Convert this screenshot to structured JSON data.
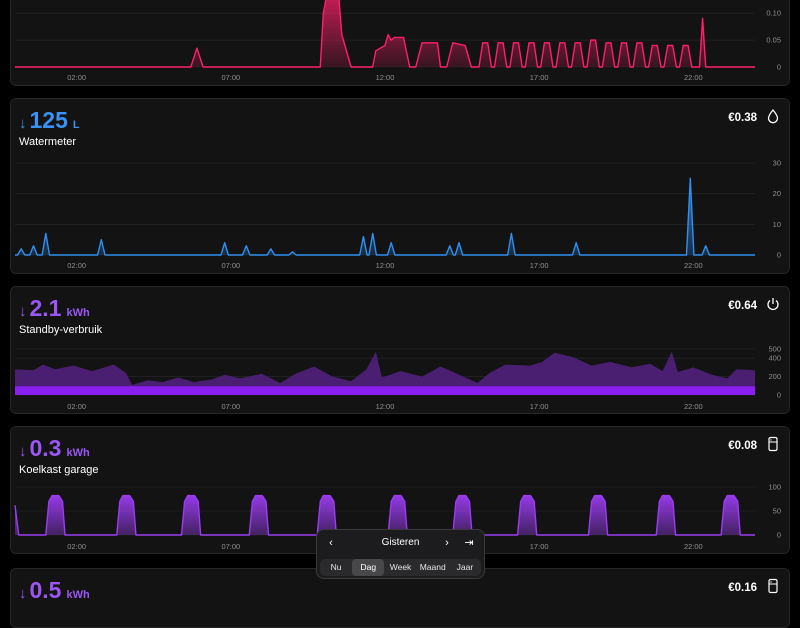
{
  "colors": {
    "gas": "#ff1f6b",
    "water": "#2f8ff0",
    "standby": "#8b2ce0",
    "fridge": "#9b3cf2",
    "label_purple": "#9b57f5",
    "label_blue": "#3a92f5"
  },
  "top_card": {
    "x_ticks": [
      "02:00",
      "07:00",
      "12:00",
      "17:00",
      "22:00"
    ],
    "y_ticks": [
      "0.10",
      "0.05",
      "0"
    ]
  },
  "water": {
    "arrow": "↓",
    "value": "125",
    "unit": "L",
    "title": "Watermeter",
    "cost": "€0.38",
    "icon": "water-drop-icon",
    "x_ticks": [
      "02:00",
      "07:00",
      "12:00",
      "17:00",
      "22:00"
    ],
    "y_ticks": [
      "30",
      "20",
      "10",
      "0"
    ]
  },
  "standby": {
    "arrow": "↓",
    "value": "2.1",
    "unit": "kWh",
    "title": "Standby-verbruik",
    "cost": "€0.64",
    "icon": "power-icon",
    "x_ticks": [
      "02:00",
      "07:00",
      "12:00",
      "17:00",
      "22:00"
    ],
    "y_ticks": [
      "500",
      "400",
      "200",
      "0"
    ]
  },
  "fridge": {
    "arrow": "↓",
    "value": "0.3",
    "unit": "kWh",
    "title": "Koelkast garage",
    "cost": "€0.08",
    "icon": "fridge-icon",
    "x_ticks": [
      "02:00",
      "07:00",
      "12:00",
      "17:00",
      "22:00"
    ],
    "y_ticks": [
      "100",
      "50",
      "0"
    ]
  },
  "fifth": {
    "arrow": "↓",
    "value": "0.5",
    "unit": "kWh",
    "cost": "€0.16",
    "icon": "fridge-icon"
  },
  "selector": {
    "label": "Gisteren",
    "prev": "‹",
    "next": "›",
    "last": "⇥",
    "tabs": [
      "Nu",
      "Dag",
      "Week",
      "Maand",
      "Jaar"
    ],
    "active_tab": "Dag"
  },
  "chart_data": [
    {
      "type": "area",
      "name": "top",
      "x_unit": "hour",
      "ylim": [
        0,
        0.13
      ],
      "points": [
        [
          0,
          0
        ],
        [
          5.7,
          0
        ],
        [
          5.9,
          0.035
        ],
        [
          6.1,
          0
        ],
        [
          9.9,
          0
        ],
        [
          10.0,
          0.1
        ],
        [
          10.1,
          0.13
        ],
        [
          10.5,
          0.13
        ],
        [
          10.6,
          0.06
        ],
        [
          10.9,
          0.0
        ],
        [
          11.6,
          0.0
        ],
        [
          11.7,
          0.03
        ],
        [
          12.0,
          0.04
        ],
        [
          12.1,
          0.06
        ],
        [
          12.2,
          0.05
        ],
        [
          12.3,
          0.055
        ],
        [
          12.6,
          0.055
        ],
        [
          12.8,
          0.0
        ],
        [
          13.0,
          0.0
        ],
        [
          13.2,
          0.045
        ],
        [
          13.7,
          0.045
        ],
        [
          13.8,
          0.0
        ],
        [
          14.0,
          0.0
        ],
        [
          14.2,
          0.045
        ],
        [
          14.6,
          0.04
        ],
        [
          14.8,
          0.0
        ],
        [
          22.2,
          0.0
        ],
        [
          22.3,
          0.09
        ],
        [
          22.4,
          0.0
        ],
        [
          24,
          0
        ]
      ],
      "pulses": [
        {
          "start": 15.1,
          "end": 15.4,
          "h": 0.045
        },
        {
          "start": 15.6,
          "end": 15.9,
          "h": 0.045
        },
        {
          "start": 16.1,
          "end": 16.4,
          "h": 0.045
        },
        {
          "start": 16.6,
          "end": 16.9,
          "h": 0.045
        },
        {
          "start": 17.1,
          "end": 17.4,
          "h": 0.045
        },
        {
          "start": 17.6,
          "end": 17.9,
          "h": 0.045
        },
        {
          "start": 18.1,
          "end": 18.4,
          "h": 0.045
        },
        {
          "start": 18.6,
          "end": 18.9,
          "h": 0.05
        },
        {
          "start": 19.1,
          "end": 19.4,
          "h": 0.045
        },
        {
          "start": 19.6,
          "end": 19.9,
          "h": 0.045
        },
        {
          "start": 20.1,
          "end": 20.4,
          "h": 0.045
        },
        {
          "start": 20.6,
          "end": 20.9,
          "h": 0.04
        },
        {
          "start": 21.1,
          "end": 21.4,
          "h": 0.04
        },
        {
          "start": 21.6,
          "end": 21.9,
          "h": 0.04
        }
      ]
    },
    {
      "type": "area",
      "name": "water",
      "x_unit": "hour",
      "ylim": [
        0,
        30
      ],
      "spikes": [
        [
          0.2,
          2
        ],
        [
          0.6,
          3
        ],
        [
          1.0,
          7
        ],
        [
          2.8,
          5
        ],
        [
          6.8,
          4
        ],
        [
          7.5,
          3
        ],
        [
          8.3,
          2
        ],
        [
          9.0,
          1
        ],
        [
          11.3,
          6
        ],
        [
          11.6,
          7
        ],
        [
          12.2,
          4
        ],
        [
          14.1,
          3
        ],
        [
          14.4,
          4
        ],
        [
          16.1,
          7
        ],
        [
          18.2,
          4
        ],
        [
          21.9,
          25
        ],
        [
          22.4,
          3
        ]
      ]
    },
    {
      "type": "area",
      "name": "standby",
      "x_unit": "hour",
      "ylim": [
        0,
        500
      ],
      "levels": [
        [
          0,
          280
        ],
        [
          0.6,
          270
        ],
        [
          0.9,
          330
        ],
        [
          1.3,
          280
        ],
        [
          1.9,
          320
        ],
        [
          2.5,
          260
        ],
        [
          3.2,
          330
        ],
        [
          3.6,
          240
        ],
        [
          3.8,
          110
        ],
        [
          4.3,
          160
        ],
        [
          4.8,
          140
        ],
        [
          5.3,
          190
        ],
        [
          5.8,
          140
        ],
        [
          6.4,
          170
        ],
        [
          6.8,
          220
        ],
        [
          7.3,
          180
        ],
        [
          8.0,
          230
        ],
        [
          8.6,
          130
        ],
        [
          9.1,
          230
        ],
        [
          9.7,
          310
        ],
        [
          10.3,
          200
        ],
        [
          10.9,
          150
        ],
        [
          11.4,
          280
        ],
        [
          11.7,
          470
        ],
        [
          11.9,
          190
        ],
        [
          12.5,
          260
        ],
        [
          13.2,
          200
        ],
        [
          13.8,
          310
        ],
        [
          14.4,
          220
        ],
        [
          15.0,
          130
        ],
        [
          15.4,
          240
        ],
        [
          15.9,
          330
        ],
        [
          16.7,
          320
        ],
        [
          17.1,
          360
        ],
        [
          17.5,
          460
        ],
        [
          18.1,
          410
        ],
        [
          18.7,
          320
        ],
        [
          19.3,
          360
        ],
        [
          20.0,
          300
        ],
        [
          20.6,
          340
        ],
        [
          21.0,
          260
        ],
        [
          21.3,
          470
        ],
        [
          21.5,
          250
        ],
        [
          22.0,
          300
        ],
        [
          22.6,
          220
        ],
        [
          23.1,
          180
        ],
        [
          23.4,
          280
        ],
        [
          24,
          270
        ]
      ],
      "base": 95
    },
    {
      "type": "area",
      "name": "fridge",
      "x_unit": "hour",
      "ylim": [
        0,
        100
      ],
      "pulses_at": [
        0,
        1.3,
        3.6,
        5.7,
        7.9,
        10.1,
        12.4,
        14.5,
        16.6,
        18.9,
        21.1,
        23.2
      ]
    }
  ]
}
